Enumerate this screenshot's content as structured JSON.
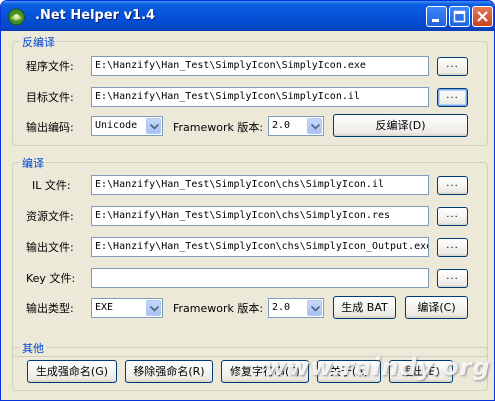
{
  "window": {
    "title": ".Net Helper v1.4",
    "icon": "dotnet-helper-logo",
    "controls": [
      "minimize-icon",
      "maximize-icon",
      "close-icon"
    ]
  },
  "decompile": {
    "legend": "反编译",
    "program_label": "程序文件:",
    "program_value": "E:\\Hanzify\\Han_Test\\SimplyIcon\\SimplyIcon.exe",
    "target_label": "目标文件:",
    "target_value": "E:\\Hanzify\\Han_Test\\SimplyIcon\\SimplyIcon.il",
    "encoding_label": "输出编码:",
    "encoding_value": "Unicode",
    "framework_label": "Framework 版本:",
    "framework_value": "2.0",
    "button": "反编译(D)",
    "browse": "..."
  },
  "compile": {
    "legend": "编译",
    "il_label": "IL 文件:",
    "il_value": "E:\\Hanzify\\Han_Test\\SimplyIcon\\chs\\SimplyIcon.il",
    "res_label": "资源文件:",
    "res_value": "E:\\Hanzify\\Han_Test\\SimplyIcon\\chs\\SimplyIcon.res",
    "out_label": "输出文件:",
    "out_value": "E:\\Hanzify\\Han_Test\\SimplyIcon\\chs\\SimplyIcon_Output.exe",
    "key_label": "Key 文件:",
    "key_value": "",
    "type_label": "输出类型:",
    "type_value": "EXE",
    "framework_label": "Framework 版本:",
    "framework_value": "2.0",
    "bat_button": "生成 BAT",
    "compile_button": "编译(C)",
    "browse": "..."
  },
  "other": {
    "legend": "其他",
    "buttons": [
      "生成强命名(G)",
      "移除强命名(R)",
      "修复字符串(F)",
      "关于(A)",
      "退出(E)"
    ]
  },
  "watermark": "www.raindy.org",
  "colors": {
    "titlebar": "#0552d9",
    "face": "#ece9d8",
    "legend_text": "#0046d5"
  }
}
